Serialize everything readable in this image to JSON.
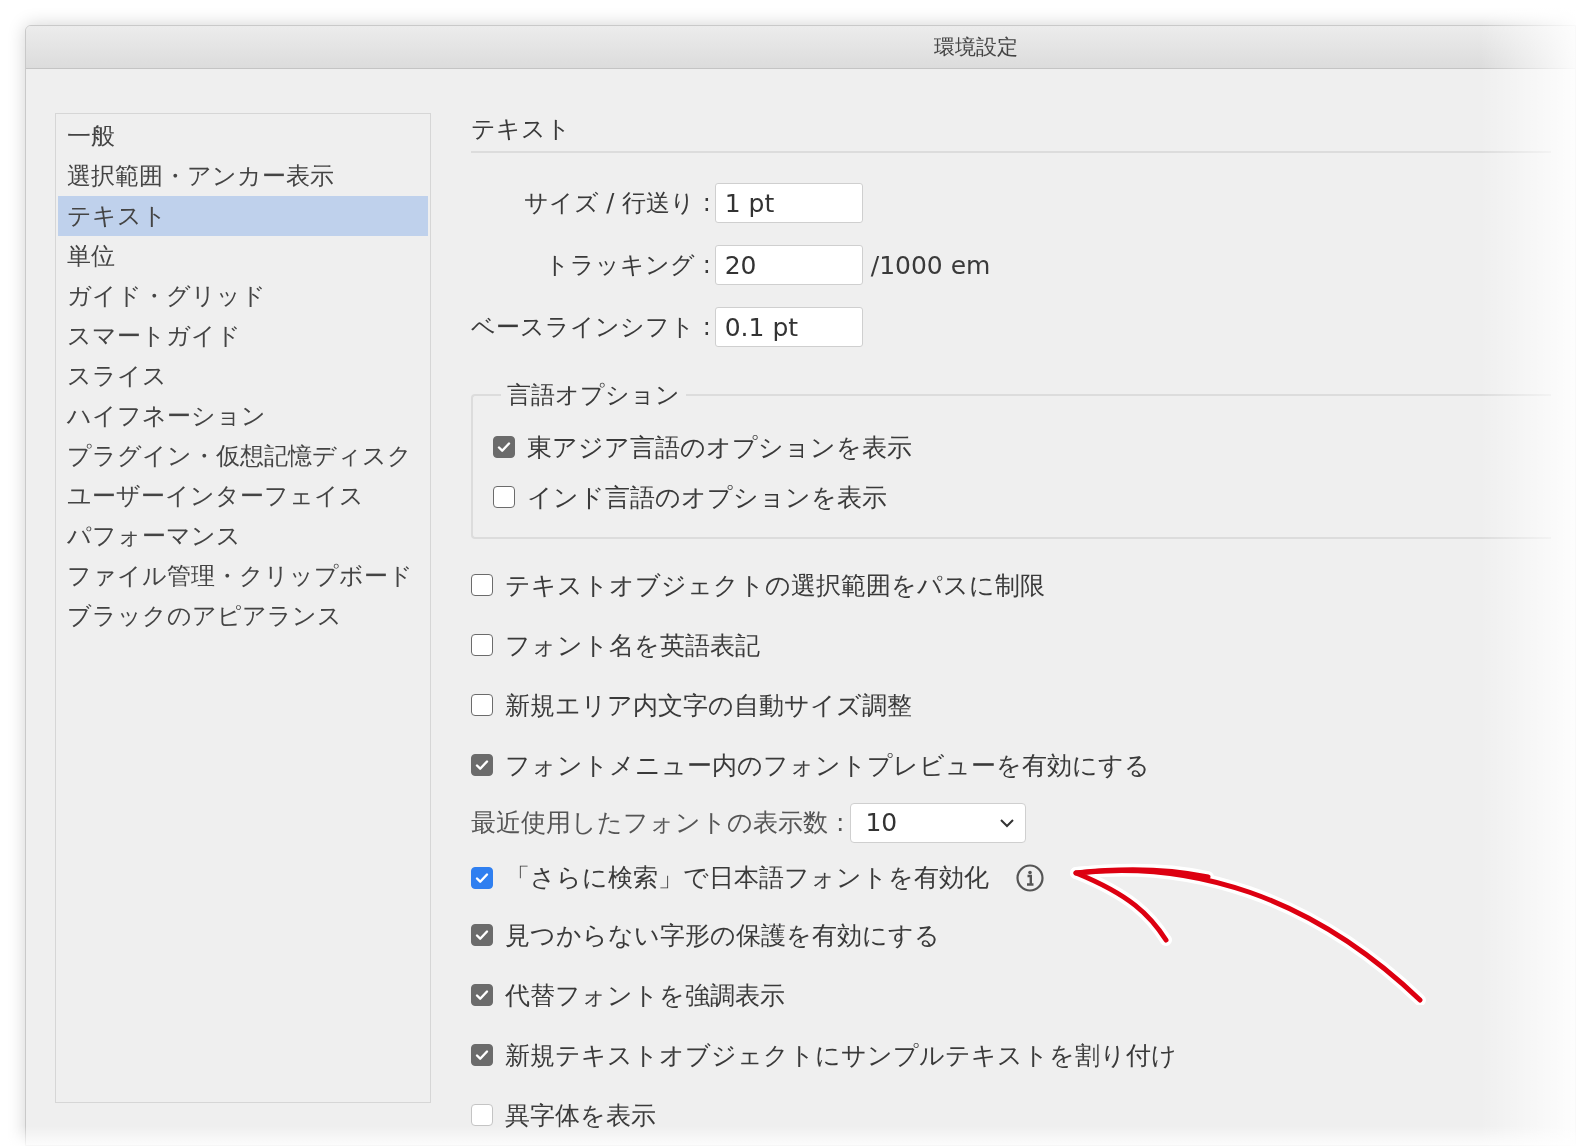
{
  "window": {
    "title": "環境設定"
  },
  "sidebar": {
    "items": [
      {
        "label": "一般",
        "selected": false
      },
      {
        "label": "選択範囲・アンカー表示",
        "selected": false
      },
      {
        "label": "テキスト",
        "selected": true
      },
      {
        "label": "単位",
        "selected": false
      },
      {
        "label": "ガイド・グリッド",
        "selected": false
      },
      {
        "label": "スマートガイド",
        "selected": false
      },
      {
        "label": "スライス",
        "selected": false
      },
      {
        "label": "ハイフネーション",
        "selected": false
      },
      {
        "label": "プラグイン・仮想記憶ディスク",
        "selected": false
      },
      {
        "label": "ユーザーインターフェイス",
        "selected": false
      },
      {
        "label": "パフォーマンス",
        "selected": false
      },
      {
        "label": "ファイル管理・クリップボード",
        "selected": false
      },
      {
        "label": "ブラックのアピアランス",
        "selected": false
      }
    ]
  },
  "panel": {
    "title": "テキスト",
    "fields": [
      {
        "label": "サイズ / 行送り :",
        "value": "1 pt"
      },
      {
        "label": "トラッキング :",
        "value": "20",
        "unit": "/1000 em"
      },
      {
        "label": "ベースラインシフト :",
        "value": "0.1 pt"
      }
    ],
    "language_options": {
      "title": "言語オプション",
      "options": [
        {
          "label": "東アジア言語のオプションを表示",
          "checked": true
        },
        {
          "label": "インド言語のオプションを表示",
          "checked": false
        }
      ]
    },
    "settings": [
      {
        "kind": "checkbox",
        "label": "テキストオブジェクトの選択範囲をパスに制限",
        "checked": false,
        "color": "#6b6b6b"
      },
      {
        "kind": "checkbox",
        "label": "フォント名を英語表記",
        "checked": false,
        "color": "#6b6b6b"
      },
      {
        "kind": "checkbox",
        "label": "新規エリア内文字の自動サイズ調整",
        "checked": false,
        "color": "#6b6b6b"
      },
      {
        "kind": "checkbox",
        "label": "フォントメニュー内のフォントプレビューを有効にする",
        "checked": true,
        "color": "#6b6b6b"
      },
      {
        "kind": "dropdown",
        "label": "最近使用したフォントの表示数 :",
        "value": "10"
      },
      {
        "kind": "checkbox",
        "label": "「さらに検索」で日本語フォントを有効化",
        "checked": true,
        "color": "#2f7ff0",
        "info": true
      },
      {
        "kind": "checkbox",
        "label": "見つからない字形の保護を有効にする",
        "checked": true,
        "color": "#6b6b6b"
      },
      {
        "kind": "checkbox",
        "label": "代替フォントを強調表示",
        "checked": true,
        "color": "#6b6b6b"
      },
      {
        "kind": "checkbox",
        "label": "新規テキストオブジェクトにサンプルテキストを割り付け",
        "checked": true,
        "color": "#6b6b6b"
      },
      {
        "kind": "checkbox",
        "label": "異字体を表示",
        "checked": false,
        "color": "#c4c4c4"
      }
    ]
  }
}
